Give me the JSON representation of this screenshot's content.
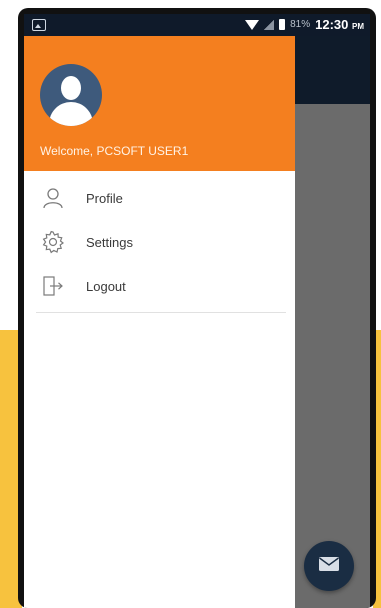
{
  "status_bar": {
    "battery": "81%",
    "time": "12:30",
    "ampm": "PM"
  },
  "drawer": {
    "welcome": "Welcome, PCSOFT USER1",
    "items": [
      {
        "label": "Profile",
        "icon": "user-icon"
      },
      {
        "label": "Settings",
        "icon": "gear-icon"
      },
      {
        "label": "Logout",
        "icon": "logout-icon"
      }
    ]
  },
  "fab": {
    "icon": "mail-icon"
  },
  "colors": {
    "header": "#f47f1f",
    "avatar": "#3e5a7c",
    "app_bar": "#0f1b2a",
    "overlay": "#6b6b6b",
    "fab": "#1a2d43",
    "backdrop_accent": "#f7c23e"
  }
}
